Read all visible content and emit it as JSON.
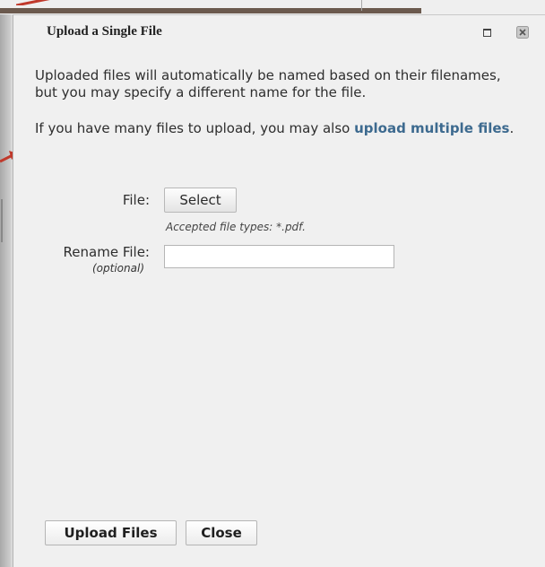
{
  "dialog": {
    "title": "Upload a Single File",
    "intro_text": "Uploaded files will automatically be named based on their filenames, but you may specify a different name for the file.",
    "multi_prefix": "If you have many files to upload, you may also ",
    "multi_link": "upload multiple files",
    "multi_suffix": "."
  },
  "form": {
    "file_label": "File:",
    "select_label": "Select",
    "accepted_hint": "Accepted file types: *.pdf.",
    "rename_label": "Rename File:",
    "rename_optional": "(optional)",
    "rename_value": ""
  },
  "buttons": {
    "upload_label": "Upload Files",
    "close_label": "Close"
  },
  "colors": {
    "link": "#3d6a8f",
    "arrow": "#c0392b"
  },
  "icons": {
    "maximize": "maximize-icon",
    "close": "close-icon"
  }
}
